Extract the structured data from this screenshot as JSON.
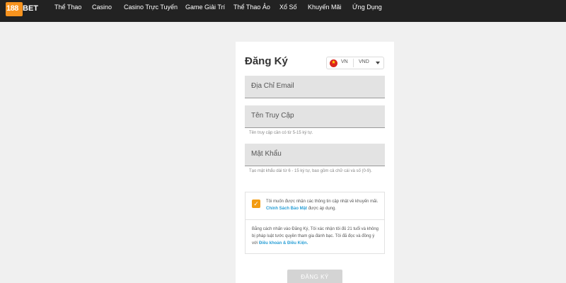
{
  "brand": {
    "logo_number": "188",
    "logo_suffix": "BET",
    "accent_color": "#f7931e"
  },
  "nav": {
    "items": [
      {
        "label": "Thể Thao"
      },
      {
        "label": "Casino"
      },
      {
        "label": "Casino Trực Tuyến"
      },
      {
        "label": "Game Giải Trí"
      },
      {
        "label": "Thể Thao Ảo"
      },
      {
        "label": "Xổ Số"
      },
      {
        "label": "Khuyến Mãi"
      },
      {
        "label": "Ứng Dụng"
      }
    ]
  },
  "form": {
    "title": "Đăng Ký",
    "language": {
      "code": "VN",
      "flag_icon": "vietnam-flag-icon"
    },
    "currency": {
      "value": "VND"
    },
    "email": {
      "placeholder": "Địa Chỉ Email"
    },
    "username": {
      "placeholder": "Tên Truy Cập",
      "hint": "Tên truy cập cần có từ 5-15 ký tự."
    },
    "password": {
      "placeholder": "Mật Khẩu",
      "hint": "Tạo mật khẩu dài từ 6 - 15 ký tự, bao gồm cả chữ cái và số (0-9)."
    },
    "consent": {
      "checked": true,
      "text_before": "Tôi muốn được nhận các thông tin cập nhật về khuyến mãi.",
      "link": "Chính Sách Bảo Mật",
      "text_after": "được áp dụng."
    },
    "terms": {
      "text_before": "Bằng cách nhấn vào Đăng Ký, Tôi xác nhận tôi đủ 21 tuổi và không bị pháp luật tước quyền tham gia đánh bạc. Tôi đã đọc và đồng ý với",
      "link": "Điều khoản & Điều Kiện."
    },
    "submit_label": "ĐĂNG KÝ"
  }
}
